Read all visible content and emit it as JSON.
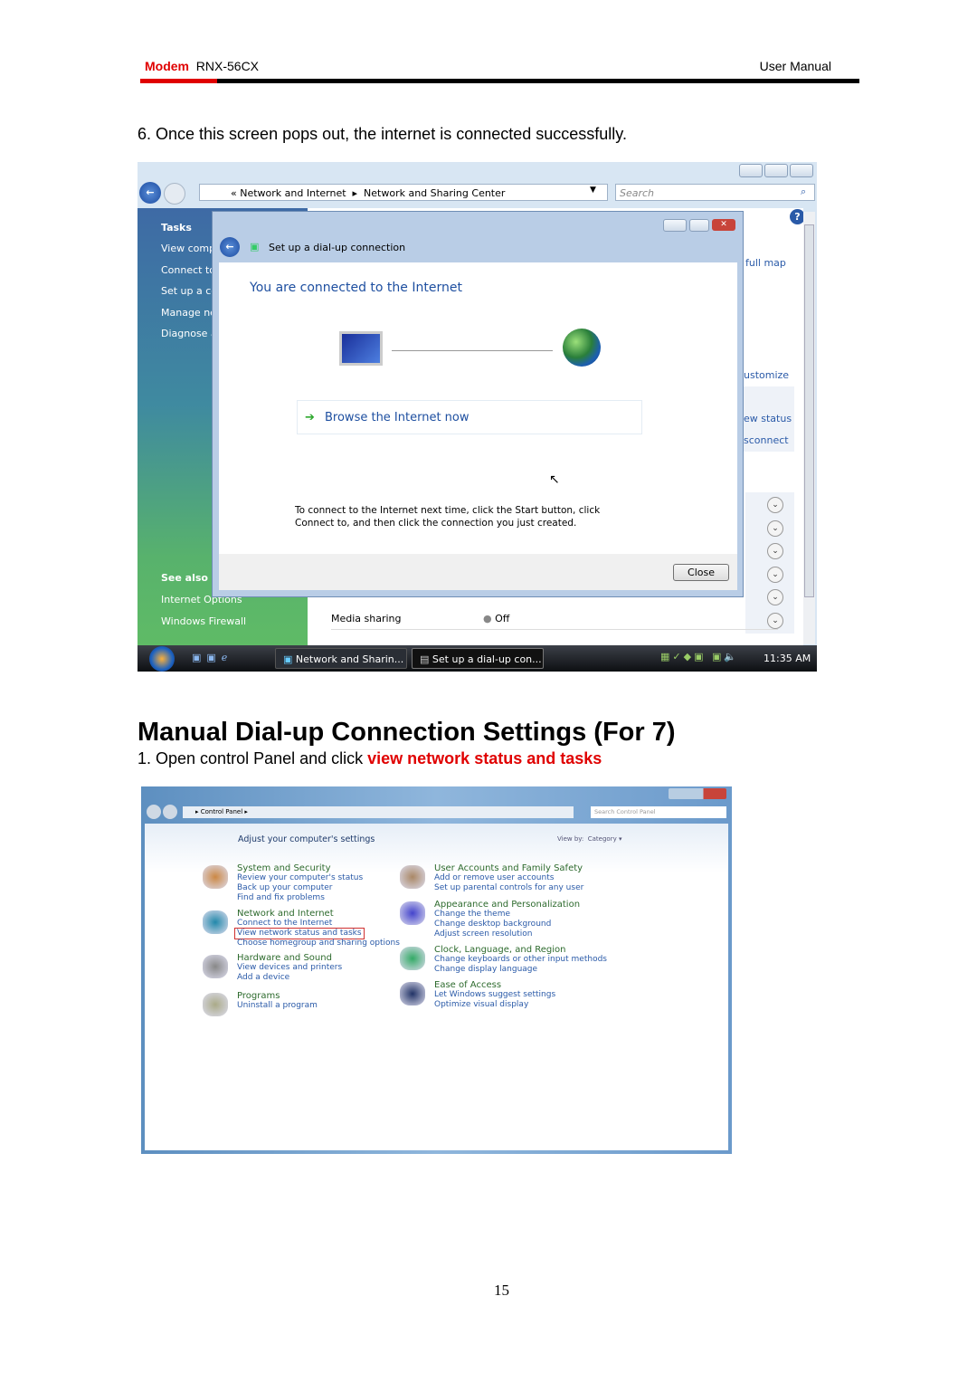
{
  "header": {
    "brand": "Modem",
    "model": "RNX-56CX",
    "right": "User Manual",
    "accent": "#e00000"
  },
  "step6": "6. Once this screen pops out, the internet is connected successfully.",
  "shot1": {
    "breadcrumb": [
      "Network and Internet",
      "Network and Sharing Center"
    ],
    "search_placeholder": "Search",
    "sidebar": {
      "tasks_title": "Tasks",
      "tasks": [
        "View comp",
        "Connect to",
        "Set up a co",
        "Manage ne",
        "Diagnose a"
      ],
      "see_also_title": "See also",
      "see_also": [
        "Internet Options",
        "Windows Firewall"
      ]
    },
    "right_links": [
      "full map",
      "ustomize",
      "ew status",
      "sconnect"
    ],
    "sharing_row": {
      "label": "Media sharing",
      "value": "Off"
    },
    "dialog": {
      "title": "Set up a dial-up connection",
      "heading": "You are connected to the Internet",
      "browse": "Browse the Internet now",
      "note1": "To connect to the Internet next time, click the Start button, click",
      "note2": "Connect to, and then click the connection you just created.",
      "close": "Close"
    },
    "taskbar": {
      "items": [
        "Network and Sharin...",
        "Set up a dial-up con..."
      ],
      "clock": "11:35 AM"
    }
  },
  "section_title": "Manual Dial-up Connection Settings (For 7)",
  "step1": {
    "text": "1. Open control Panel and click ",
    "link": "view network status and tasks"
  },
  "shot2": {
    "breadcrumb": "Control Panel",
    "search_placeholder": "Search Control Panel",
    "heading": "Adjust your computer's settings",
    "viewby": "View by:",
    "viewby_value": "Category",
    "left": [
      {
        "title": "System and Security",
        "links": [
          "Review your computer's status",
          "Back up your computer",
          "Find and fix problems"
        ]
      },
      {
        "title": "Network and Internet",
        "links": [
          "Connect to the Internet",
          "View network status and tasks",
          "Choose homegroup and sharing options"
        ]
      },
      {
        "title": "Hardware and Sound",
        "links": [
          "View devices and printers",
          "Add a device"
        ]
      },
      {
        "title": "Programs",
        "links": [
          "Uninstall a program"
        ]
      }
    ],
    "right": [
      {
        "title": "User Accounts and Family Safety",
        "links": [
          "Add or remove user accounts",
          "Set up parental controls for any user"
        ]
      },
      {
        "title": "Appearance and Personalization",
        "links": [
          "Change the theme",
          "Change desktop background",
          "Adjust screen resolution"
        ]
      },
      {
        "title": "Clock, Language, and Region",
        "links": [
          "Change keyboards or other input methods",
          "Change display language"
        ]
      },
      {
        "title": "Ease of Access",
        "links": [
          "Let Windows suggest settings",
          "Optimize visual display"
        ]
      }
    ]
  },
  "page_number": "15"
}
